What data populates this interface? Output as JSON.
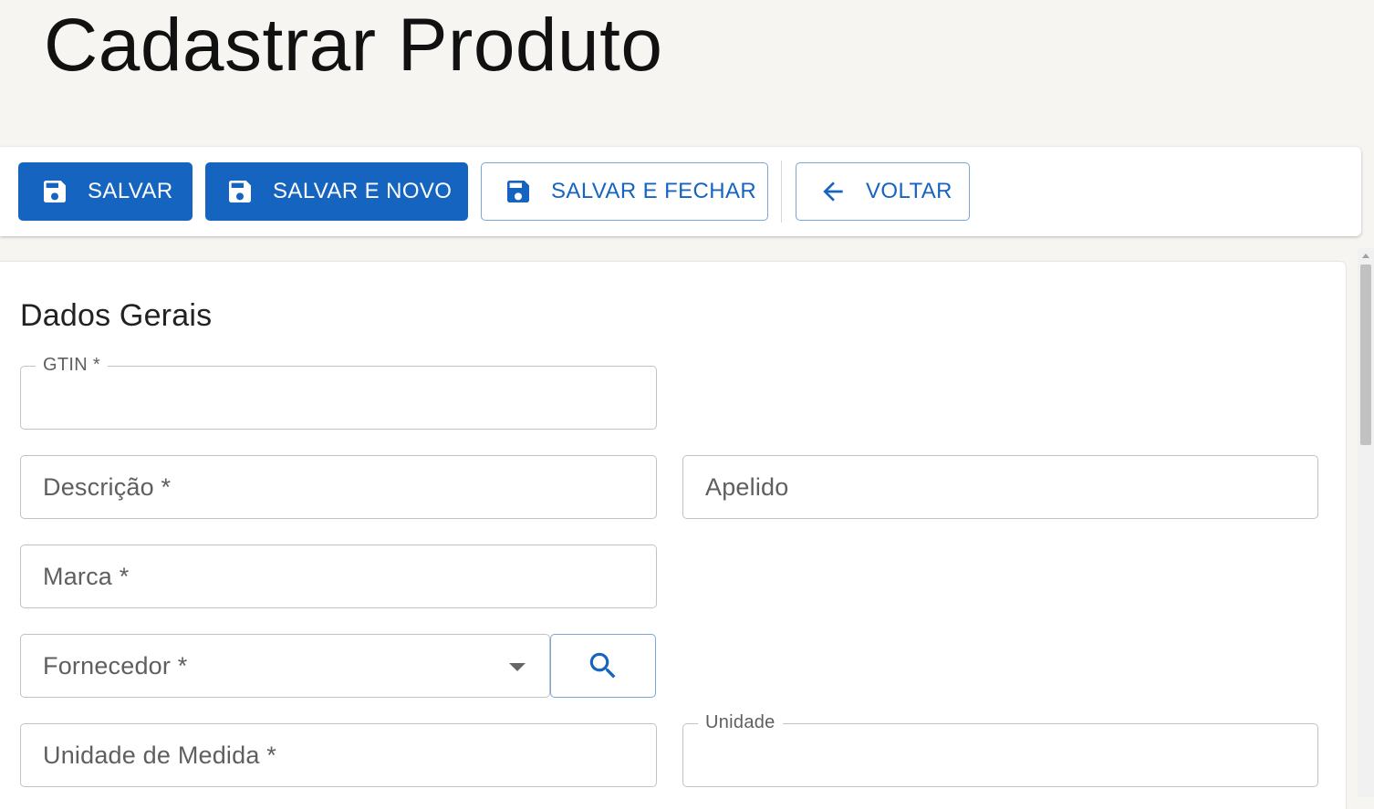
{
  "page": {
    "title": "Cadastrar Produto"
  },
  "toolbar": {
    "save_label": "SALVAR",
    "save_new_label": "SALVAR E NOVO",
    "save_close_label": "SALVAR E FECHAR",
    "back_label": "VOLTAR",
    "icons": {
      "save": "save-icon",
      "back": "arrow-left-icon"
    }
  },
  "form": {
    "section_title": "Dados Gerais",
    "gtin": {
      "label": "GTIN *",
      "value": ""
    },
    "descricao": {
      "placeholder": "Descrição *",
      "value": ""
    },
    "apelido": {
      "placeholder": "Apelido",
      "value": ""
    },
    "marca": {
      "placeholder": "Marca *",
      "value": ""
    },
    "fornecedor": {
      "placeholder": "Fornecedor *",
      "value": ""
    },
    "unidade_medida": {
      "placeholder": "Unidade de Medida *",
      "value": ""
    },
    "unidade": {
      "label": "Unidade",
      "value": ""
    }
  },
  "colors": {
    "primary": "#1565c0",
    "background": "#f6f5f2",
    "border": "#c2c2c2",
    "text_secondary": "#5f5f5f"
  }
}
